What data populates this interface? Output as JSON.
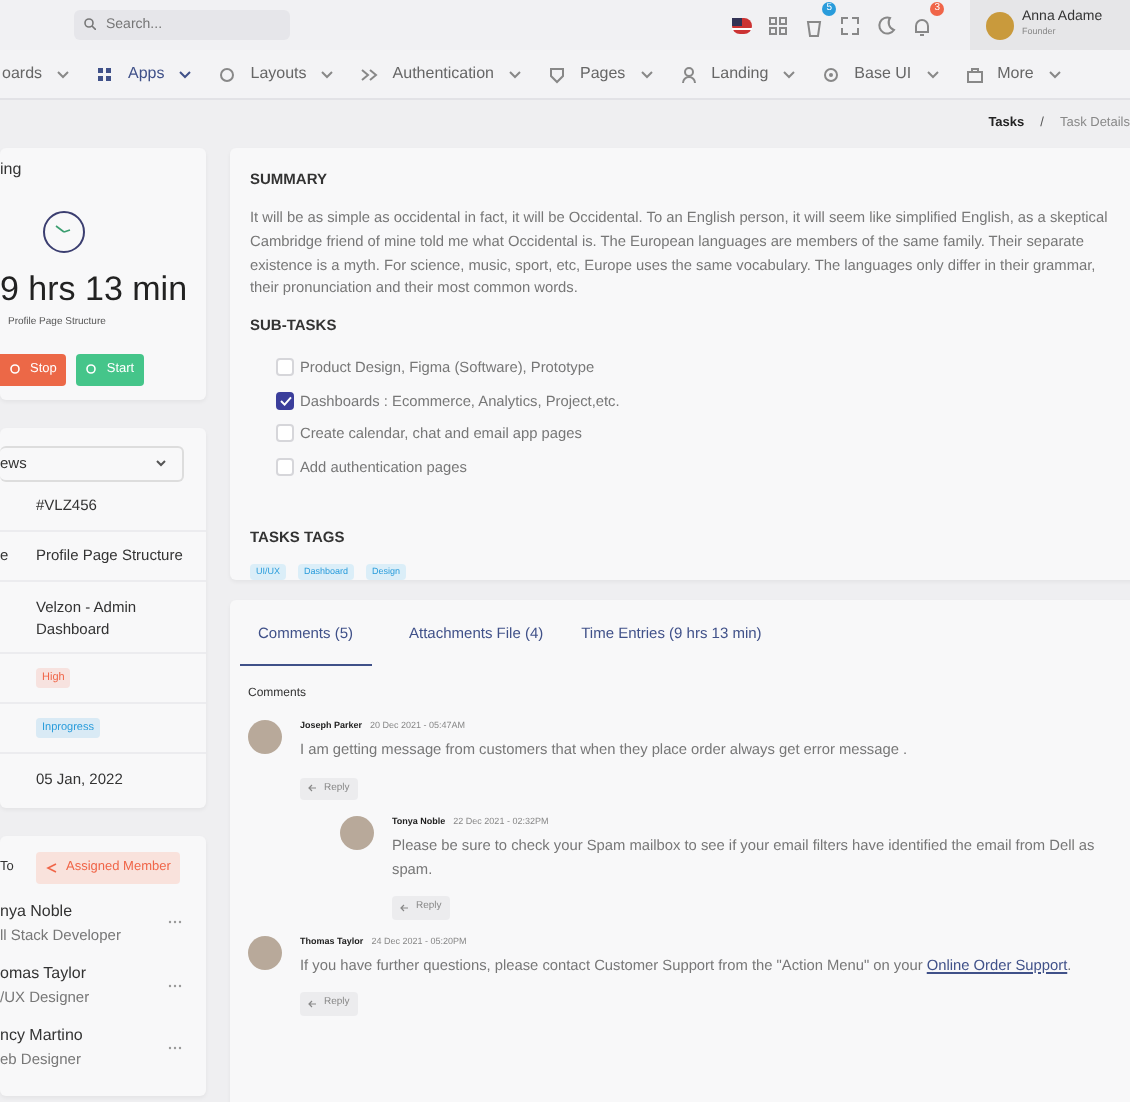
{
  "search": {
    "placeholder": "Search..."
  },
  "header_icons": [
    {
      "kind": "flag"
    },
    {
      "kind": "apps"
    },
    {
      "kind": "cart",
      "badge": "5"
    },
    {
      "kind": "fullscreen"
    },
    {
      "kind": "moon"
    },
    {
      "kind": "bell",
      "badge": "3"
    }
  ],
  "user": {
    "name": "Anna Adame",
    "role": "Founder"
  },
  "nav": [
    {
      "label": "oards",
      "kind": "none",
      "selected": false
    },
    {
      "label": "Apps",
      "kind": "apps",
      "selected": true
    },
    {
      "label": "Layouts",
      "kind": "layouts",
      "selected": false
    },
    {
      "label": "Authentication",
      "kind": "auth",
      "selected": false
    },
    {
      "label": "Pages",
      "kind": "pages",
      "selected": false
    },
    {
      "label": "Landing",
      "kind": "landing",
      "selected": false
    },
    {
      "label": "Base UI",
      "kind": "baseui",
      "selected": false
    },
    {
      "label": "More",
      "kind": "more",
      "selected": false
    }
  ],
  "breadcrumb": [
    "Tasks",
    "Task Details"
  ],
  "breadcrumb_separator": "/",
  "timer": {
    "title": "ing",
    "time": "9 hrs 13 min",
    "task": "Profile Page Structure",
    "buttons": [
      {
        "label": "Stop",
        "kind": "stop"
      },
      {
        "label": "Start",
        "kind": "start"
      }
    ]
  },
  "details": {
    "select": "ews",
    "rows": [
      {
        "label": "",
        "value": "#VLZ456",
        "kind": "text"
      },
      {
        "label": "e",
        "value": "Profile Page Structure",
        "kind": "text"
      },
      {
        "label": "",
        "value": "Velzon - Admin Dashboard",
        "kind": "text"
      },
      {
        "label": "",
        "value": "High",
        "kind": "badge",
        "color": "#f06548"
      },
      {
        "label": "",
        "value": "Inprogress",
        "kind": "badge",
        "color": "#299cdb"
      },
      {
        "label": "",
        "value": "05 Jan, 2022",
        "kind": "text"
      }
    ]
  },
  "assigned": {
    "title": "To",
    "button": "Assigned Member",
    "members": [
      {
        "name": "nya Noble",
        "role": "ll Stack Developer"
      },
      {
        "name": "omas Taylor",
        "role": "/UX Designer"
      },
      {
        "name": "ncy Martino",
        "role": "eb Designer"
      }
    ]
  },
  "summary": {
    "title": "SUMMARY",
    "text": "It will be as simple as occidental in fact, it will be Occidental. To an English person, it will seem like simplified English, as a skeptical Cambridge friend of mine told me what Occidental is. The European languages are members of the same family. Their separate existence is a myth. For science, music, sport, etc, Europe uses the same vocabulary. The languages only differ in their grammar, their pronunciation and their most common words.",
    "subtasks_title": "SUB-TASKS",
    "subtasks": [
      {
        "label": "Product Design, Figma (Software), Prototype",
        "checked": false
      },
      {
        "label": "Dashboards : Ecommerce, Analytics, Project,etc.",
        "checked": true
      },
      {
        "label": "Create calendar, chat and email app pages",
        "checked": false
      },
      {
        "label": "Add authentication pages",
        "checked": false
      }
    ],
    "tags_title": "TASKS TAGS",
    "tags": [
      "UI/UX",
      "Dashboard",
      "Design"
    ]
  },
  "comments": {
    "tabs": [
      {
        "label": "Comments (5)",
        "selected": true
      },
      {
        "label": "Attachments File (4)",
        "selected": false
      },
      {
        "label": "Time Entries (9 hrs 13 min)",
        "selected": false
      }
    ],
    "heading": "Comments",
    "items": [
      {
        "author": "Joseph Parker",
        "date": "20 Dec 2021 - 05:47AM",
        "text": "I am getting message from customers that when they place order always get error message .",
        "reply": "Reply",
        "children": [
          {
            "author": "Tonya Noble",
            "date": "22 Dec 2021 - 02:32PM",
            "text": "Please be sure to check your Spam mailbox to see if your email filters have identified the email from Dell as spam.",
            "reply": "Reply"
          }
        ]
      },
      {
        "author": "Thomas Taylor",
        "date": "24 Dec 2021 - 05:20PM",
        "text": "If you have further questions, please contact Customer Support from the \"Action Menu\" on your",
        "link": "Online Order Support",
        "after": ".",
        "reply": "Reply"
      }
    ]
  }
}
